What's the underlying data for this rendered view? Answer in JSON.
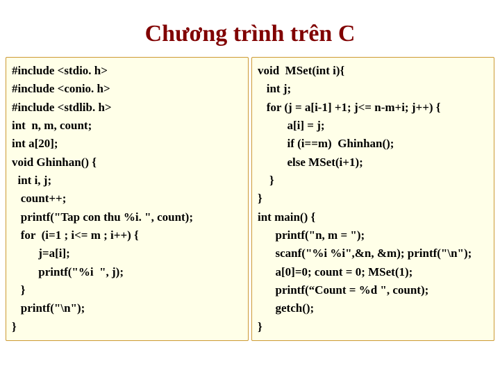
{
  "title": "Chương trình trên C",
  "left_code": "#include <stdio. h>\n#include <conio. h>\n#include <stdlib. h>\nint  n, m, count;\nint a[20];\nvoid Ghinhan() {\n  int i, j;\n   count++;\n   printf(\"Tap con thu %i. \", count);\n   for  (i=1 ; i<= m ; i++) {\n         j=a[i];\n         printf(\"%i  \", j);\n   }\n   printf(\"\\n\");\n}",
  "right_code": "void  MSet(int i){\n   int j;\n   for (j = a[i-1] +1; j<= n-m+i; j++) {\n          a[i] = j;\n          if (i==m)  Ghinhan();\n          else MSet(i+1);\n    }\n}\nint main() {\n      printf(\"n, m = \");\n      scanf(\"%i %i\",&n, &m); printf(\"\\n\");\n      a[0]=0; count = 0; MSet(1);\n      printf(“Count = %d \", count);\n      getch();\n}"
}
